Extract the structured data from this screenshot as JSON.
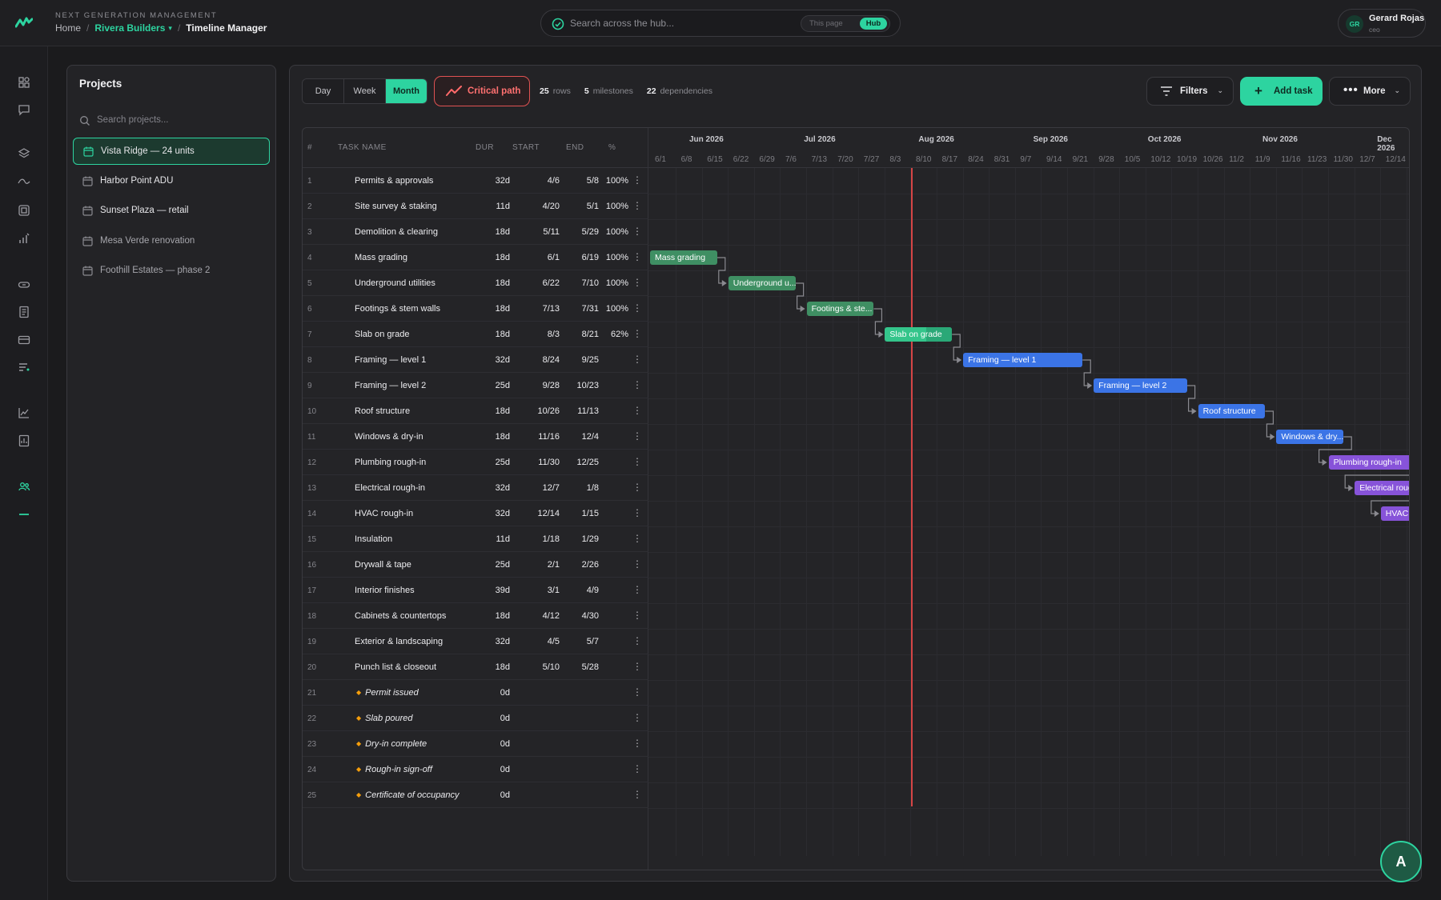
{
  "header": {
    "brand_subtitle": "NEXT GENERATION MANAGEMENT",
    "breadcrumb": {
      "home": "Home",
      "separator": "/",
      "org": "Rivera Builders",
      "current": "Timeline Manager"
    },
    "search": {
      "placeholder": "Search across the hub...",
      "scope_page": "This page",
      "scope_hub": "Hub"
    },
    "user": {
      "initials": "GR",
      "name": "Gerard Rojas",
      "role": "ceo"
    }
  },
  "rail": {
    "icons": [
      "dashboard-icon",
      "chat-icon",
      "layers-icon",
      "trend-icon",
      "gallery-icon",
      "bar-chart-icon",
      "link-icon",
      "document-icon",
      "card-icon",
      "list-icon",
      "line-chart-icon",
      "report-icon",
      "team-icon",
      "timeline-icon"
    ]
  },
  "projects": {
    "title": "Projects",
    "search_placeholder": "Search projects...",
    "items": [
      {
        "label": "Vista Ridge — 24 units",
        "active": true
      },
      {
        "label": "Harbor Point ADU"
      },
      {
        "label": "Sunset Plaza — retail"
      },
      {
        "label": "Mesa Verde renovation",
        "dim": true
      },
      {
        "label": "Foothill Estates — phase 2",
        "dim": true
      }
    ]
  },
  "toolbar": {
    "views": [
      "Day",
      "Week",
      "Month"
    ],
    "active_view": "Month",
    "critical_path": "Critical path",
    "stats": {
      "rows": "25",
      "rows_label": "rows",
      "milestones": "5",
      "milestones_label": "milestones",
      "dependencies": "22",
      "dependencies_label": "dependencies"
    },
    "filters": "Filters",
    "add_task": "Add task",
    "more": "More"
  },
  "table": {
    "columns": {
      "num": "#",
      "name": "TASK NAME",
      "dur": "DUR",
      "start": "START",
      "end": "END",
      "pct": "%"
    },
    "rows": [
      {
        "num": "1",
        "name": "Permits & approvals",
        "dur": "32d",
        "start": "4/6",
        "end": "5/8",
        "pct": "100%"
      },
      {
        "num": "2",
        "name": "Site survey & staking",
        "dur": "11d",
        "start": "4/20",
        "end": "5/1",
        "pct": "100%"
      },
      {
        "num": "3",
        "name": "Demolition & clearing",
        "dur": "18d",
        "start": "5/11",
        "end": "5/29",
        "pct": "100%"
      },
      {
        "num": "4",
        "name": "Mass grading",
        "dur": "18d",
        "start": "6/1",
        "end": "6/19",
        "pct": "100%"
      },
      {
        "num": "5",
        "name": "Underground utilities",
        "dur": "18d",
        "start": "6/22",
        "end": "7/10",
        "pct": "100%"
      },
      {
        "num": "6",
        "name": "Footings & stem walls",
        "dur": "18d",
        "start": "7/13",
        "end": "7/31",
        "pct": "100%"
      },
      {
        "num": "7",
        "name": "Slab on grade",
        "dur": "18d",
        "start": "8/3",
        "end": "8/21",
        "pct": "62%"
      },
      {
        "num": "8",
        "name": "Framing — level 1",
        "dur": "32d",
        "start": "8/24",
        "end": "9/25",
        "pct": ""
      },
      {
        "num": "9",
        "name": "Framing — level 2",
        "dur": "25d",
        "start": "9/28",
        "end": "10/23",
        "pct": ""
      },
      {
        "num": "10",
        "name": "Roof structure",
        "dur": "18d",
        "start": "10/26",
        "end": "11/13",
        "pct": ""
      },
      {
        "num": "11",
        "name": "Windows & dry-in",
        "dur": "18d",
        "start": "11/16",
        "end": "12/4",
        "pct": ""
      },
      {
        "num": "12",
        "name": "Plumbing rough-in",
        "dur": "25d",
        "start": "11/30",
        "end": "12/25",
        "pct": ""
      },
      {
        "num": "13",
        "name": "Electrical rough-in",
        "dur": "32d",
        "start": "12/7",
        "end": "1/8",
        "pct": ""
      },
      {
        "num": "14",
        "name": "HVAC rough-in",
        "dur": "32d",
        "start": "12/14",
        "end": "1/15",
        "pct": ""
      },
      {
        "num": "15",
        "name": "Insulation",
        "dur": "11d",
        "start": "1/18",
        "end": "1/29",
        "pct": ""
      },
      {
        "num": "16",
        "name": "Drywall & tape",
        "dur": "25d",
        "start": "2/1",
        "end": "2/26",
        "pct": ""
      },
      {
        "num": "17",
        "name": "Interior finishes",
        "dur": "39d",
        "start": "3/1",
        "end": "4/9",
        "pct": ""
      },
      {
        "num": "18",
        "name": "Cabinets & countertops",
        "dur": "18d",
        "start": "4/12",
        "end": "4/30",
        "pct": ""
      },
      {
        "num": "19",
        "name": "Exterior & landscaping",
        "dur": "32d",
        "start": "4/5",
        "end": "5/7",
        "pct": ""
      },
      {
        "num": "20",
        "name": "Punch list & closeout",
        "dur": "18d",
        "start": "5/10",
        "end": "5/28",
        "pct": ""
      },
      {
        "num": "21",
        "name": "Permit issued",
        "dur": "0d",
        "start": "",
        "end": "",
        "pct": "",
        "milestone": true
      },
      {
        "num": "22",
        "name": "Slab poured",
        "dur": "0d",
        "start": "",
        "end": "",
        "pct": "",
        "milestone": true
      },
      {
        "num": "23",
        "name": "Dry-in complete",
        "dur": "0d",
        "start": "",
        "end": "",
        "pct": "",
        "milestone": true
      },
      {
        "num": "24",
        "name": "Rough-in sign-off",
        "dur": "0d",
        "start": "",
        "end": "",
        "pct": "",
        "milestone": true
      },
      {
        "num": "25",
        "name": "Certificate of occupancy",
        "dur": "0d",
        "start": "",
        "end": "",
        "pct": "",
        "milestone": true
      }
    ]
  },
  "timeline": {
    "months": [
      "Jun 2026",
      "Jul 2026",
      "Aug 2026",
      "Sep 2026",
      "Oct 2026",
      "Nov 2026",
      "Dec 2026"
    ],
    "weeks": [
      "6/1",
      "6/8",
      "6/15",
      "6/22",
      "6/29",
      "7/6",
      "7/13",
      "7/20",
      "7/27",
      "8/3",
      "8/10",
      "8/17",
      "8/24",
      "8/31",
      "9/7",
      "9/14",
      "9/21",
      "9/28",
      "10/5",
      "10/12",
      "10/19",
      "10/26",
      "11/2",
      "11/9",
      "11/16",
      "11/23",
      "11/30",
      "12/7",
      "12/14"
    ],
    "today": "8/10",
    "bars": [
      {
        "row": 4,
        "label": "Mass grading",
        "start": "6/1",
        "end": "6/19",
        "progress": 1.0,
        "color": "green"
      },
      {
        "row": 5,
        "label": "Underground u...",
        "start": "6/22",
        "end": "7/10",
        "progress": 1.0,
        "color": "green"
      },
      {
        "row": 6,
        "label": "Footings & ste...",
        "start": "7/13",
        "end": "7/31",
        "progress": 1.0,
        "color": "green"
      },
      {
        "row": 7,
        "label": "Slab on grade",
        "start": "8/3",
        "end": "8/21",
        "progress": 0.62,
        "color": "mint"
      },
      {
        "row": 8,
        "label": "Framing — level 1",
        "start": "8/24",
        "end": "9/25",
        "progress": 0,
        "color": "blue"
      },
      {
        "row": 9,
        "label": "Framing — level 2",
        "start": "9/28",
        "end": "10/23",
        "progress": 0,
        "color": "blue"
      },
      {
        "row": 10,
        "label": "Roof structure",
        "start": "10/26",
        "end": "11/13",
        "progress": 0,
        "color": "blue"
      },
      {
        "row": 11,
        "label": "Windows & dry...",
        "start": "11/16",
        "end": "12/4",
        "progress": 0,
        "color": "blue"
      },
      {
        "row": 12,
        "label": "Plumbing rough-in",
        "start": "11/30",
        "end": "12/25",
        "progress": 0,
        "color": "purple"
      },
      {
        "row": 13,
        "label": "Electrical rough-in",
        "start": "12/7",
        "end": "1/8",
        "progress": 0,
        "color": "purple"
      },
      {
        "row": 14,
        "label": "HVAC rough-in",
        "start": "12/14",
        "end": "1/15",
        "progress": 0,
        "color": "purple"
      }
    ],
    "colors": {
      "green": "#3f8f63",
      "mint": "#34c58b",
      "blue": "#3b74e6",
      "purple": "#8753d9",
      "today": "#d64545"
    }
  },
  "fab": {
    "label": "A"
  },
  "accent": "#2dd4a0"
}
